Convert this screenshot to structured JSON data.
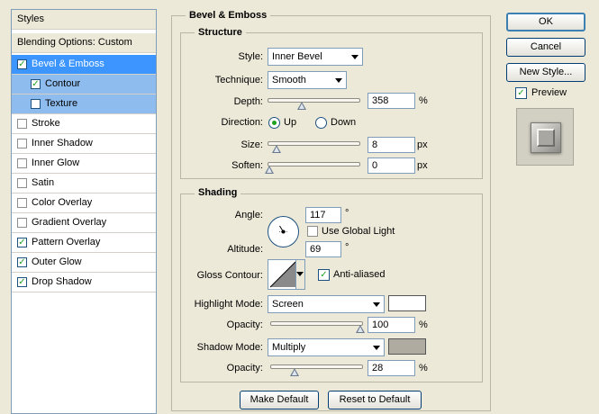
{
  "sidebar": {
    "header": "Styles",
    "blending_options": "Blending Options: Custom",
    "items": [
      {
        "label": "Bevel & Emboss",
        "checked": true,
        "state": "active"
      },
      {
        "label": "Contour",
        "checked": true,
        "state": "sub"
      },
      {
        "label": "Texture",
        "checked": false,
        "state": "sub"
      },
      {
        "label": "Stroke",
        "checked": false
      },
      {
        "label": "Inner Shadow",
        "checked": false
      },
      {
        "label": "Inner Glow",
        "checked": false
      },
      {
        "label": "Satin",
        "checked": false
      },
      {
        "label": "Color Overlay",
        "checked": false
      },
      {
        "label": "Gradient Overlay",
        "checked": false
      },
      {
        "label": "Pattern Overlay",
        "checked": true
      },
      {
        "label": "Outer Glow",
        "checked": true
      },
      {
        "label": "Drop Shadow",
        "checked": true
      }
    ]
  },
  "bevel": {
    "title": "Bevel & Emboss",
    "structure": {
      "title": "Structure",
      "style_label": "Style:",
      "style_value": "Inner Bevel",
      "technique_label": "Technique:",
      "technique_value": "Smooth",
      "depth_label": "Depth:",
      "depth_value": "358",
      "depth_unit": "%",
      "direction_label": "Direction:",
      "direction_up": "Up",
      "direction_down": "Down",
      "size_label": "Size:",
      "size_value": "8",
      "size_unit": "px",
      "soften_label": "Soften:",
      "soften_value": "0",
      "soften_unit": "px"
    },
    "shading": {
      "title": "Shading",
      "angle_label": "Angle:",
      "angle_value": "117",
      "angle_unit": "°",
      "global_light_label": "Use Global Light",
      "global_light_checked": false,
      "altitude_label": "Altitude:",
      "altitude_value": "69",
      "altitude_unit": "°",
      "gloss_label": "Gloss Contour:",
      "anti_aliased_label": "Anti-aliased",
      "anti_aliased_checked": true,
      "highlight_mode_label": "Highlight Mode:",
      "highlight_mode_value": "Screen",
      "highlight_color": "#ffffff",
      "highlight_opacity_label": "Opacity:",
      "highlight_opacity_value": "100",
      "highlight_opacity_unit": "%",
      "shadow_mode_label": "Shadow Mode:",
      "shadow_mode_value": "Multiply",
      "shadow_color": "#b0aba1",
      "shadow_opacity_label": "Opacity:",
      "shadow_opacity_value": "28",
      "shadow_opacity_unit": "%"
    },
    "make_default": "Make Default",
    "reset_default": "Reset to Default"
  },
  "actions": {
    "ok": "OK",
    "cancel": "Cancel",
    "new_style": "New Style...",
    "preview_label": "Preview",
    "preview_checked": true
  },
  "colors": {
    "accent": "#3d95ff",
    "sub_selected": "#8fbcee",
    "dialog_bg": "#ece9d8"
  }
}
